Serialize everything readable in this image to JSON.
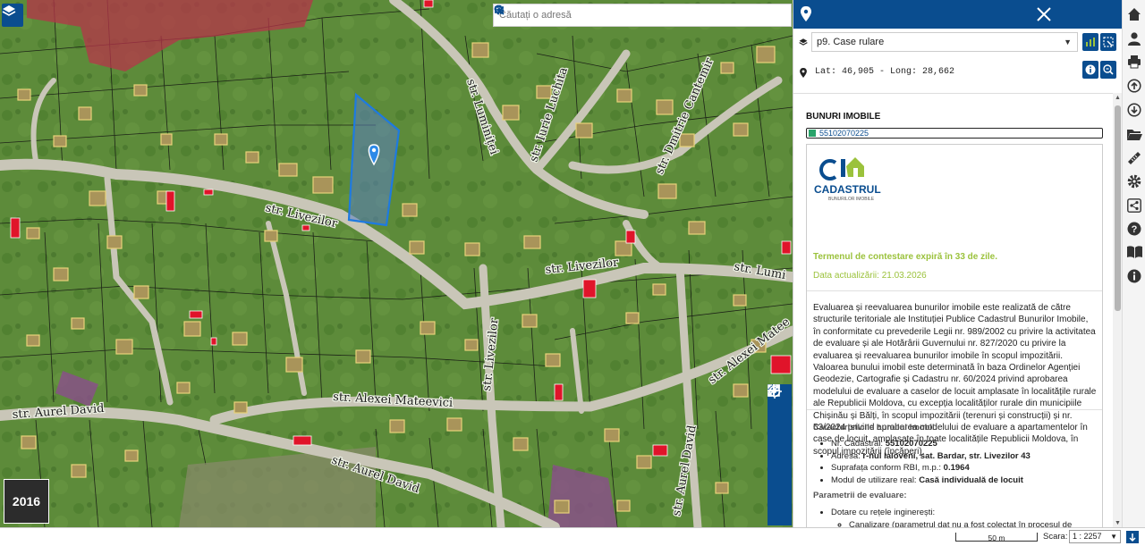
{
  "map": {
    "search_placeholder": "Căutați o adresă",
    "year": "2016",
    "roads": [
      "str. Livezilor",
      "str. Livezilor",
      "str. Livezilor",
      "str. Lumi",
      "str. Luminiței",
      "str. Iurie Luchita",
      "str. Dmitrie Cantemir",
      "str. Alexei Mateevici",
      "str. Alexei Matee",
      "str. Aurel David",
      "str. Aurel David",
      "str. Aurel David"
    ],
    "tools": [
      "locate-icon",
      "zoom-in-icon",
      "zoom-out-icon",
      "fullscreen-icon",
      "extent-icon",
      "more-icon"
    ]
  },
  "panel": {
    "layer_select": "p9. Case rulare",
    "coords": "Lat: 46,905 - Long: 28,662",
    "section_title": "BUNURI IMOBILE",
    "parcel_id": "55102070225",
    "logo_title": "CADASTRUL",
    "logo_sub": "BUNURILOR IMOBILE",
    "term": "Termenul de contestare expiră în 33 de zile.",
    "update": "Data actualizării: 21.03.2026",
    "paragraph": "Evaluarea și reevaluarea bunurilor imobile este realizată de către structurile teritoriale ale Instituției Publice Cadastrul Bunurilor Imobile, în conformitate cu prevederile Legii nr. 989/2002 cu privire la activitatea de evaluare și ale Hotărârii Guvernului nr. 827/2020 cu privire la evaluarea și reevaluarea bunurilor imobile în scopul impozitării. Valoarea bunului imobil este determinată în baza Ordinelor Agenției Geodezie, Cartografie și Cadastru nr. 60/2024 privind aprobarea modelului de evaluare a caselor de locuit amplasate în localitățile rurale ale Republicii Moldova, cu excepția localităților rurale din municipiile Chișinău și Bălți, în scopul impozitării (terenuri și construcții) și nr. 53/2024 privind aprobarea modelului de evaluare a apartamentelor în case de locuit, amplasate în toate localitățile Republicii Moldova, în scopul impozitării (încăperi).",
    "char_title": "Caracteristicile bunului imobil:",
    "chars": [
      {
        "label": "Nr. Cadastral: ",
        "value": "55102070225"
      },
      {
        "label": "Adresa: ",
        "value": "r-nul Ialoveni, sat. Bardar, str. Livezilor 43"
      },
      {
        "label": "Suprafața conform RBI, m.p.: ",
        "value": "0.1964"
      },
      {
        "label": "Modul de utilizare real: ",
        "value": "Casă individuală de locuit"
      }
    ],
    "params_title": "Parametrii de evaluare:",
    "params": [
      {
        "label": "Dotare cu rețele inginerești:",
        "value": ""
      }
    ],
    "sub_param": "Canalizare (parametrul dat nu a fost colectat în procesul de"
  },
  "bottom": {
    "scale_bar": "50 m",
    "scara_label": "Scara:",
    "scara_value": "1 : 2257"
  },
  "colors": {
    "accent": "#0a4d8f",
    "highlight": "#9bc23c",
    "parcel": "#1e7ae0"
  }
}
